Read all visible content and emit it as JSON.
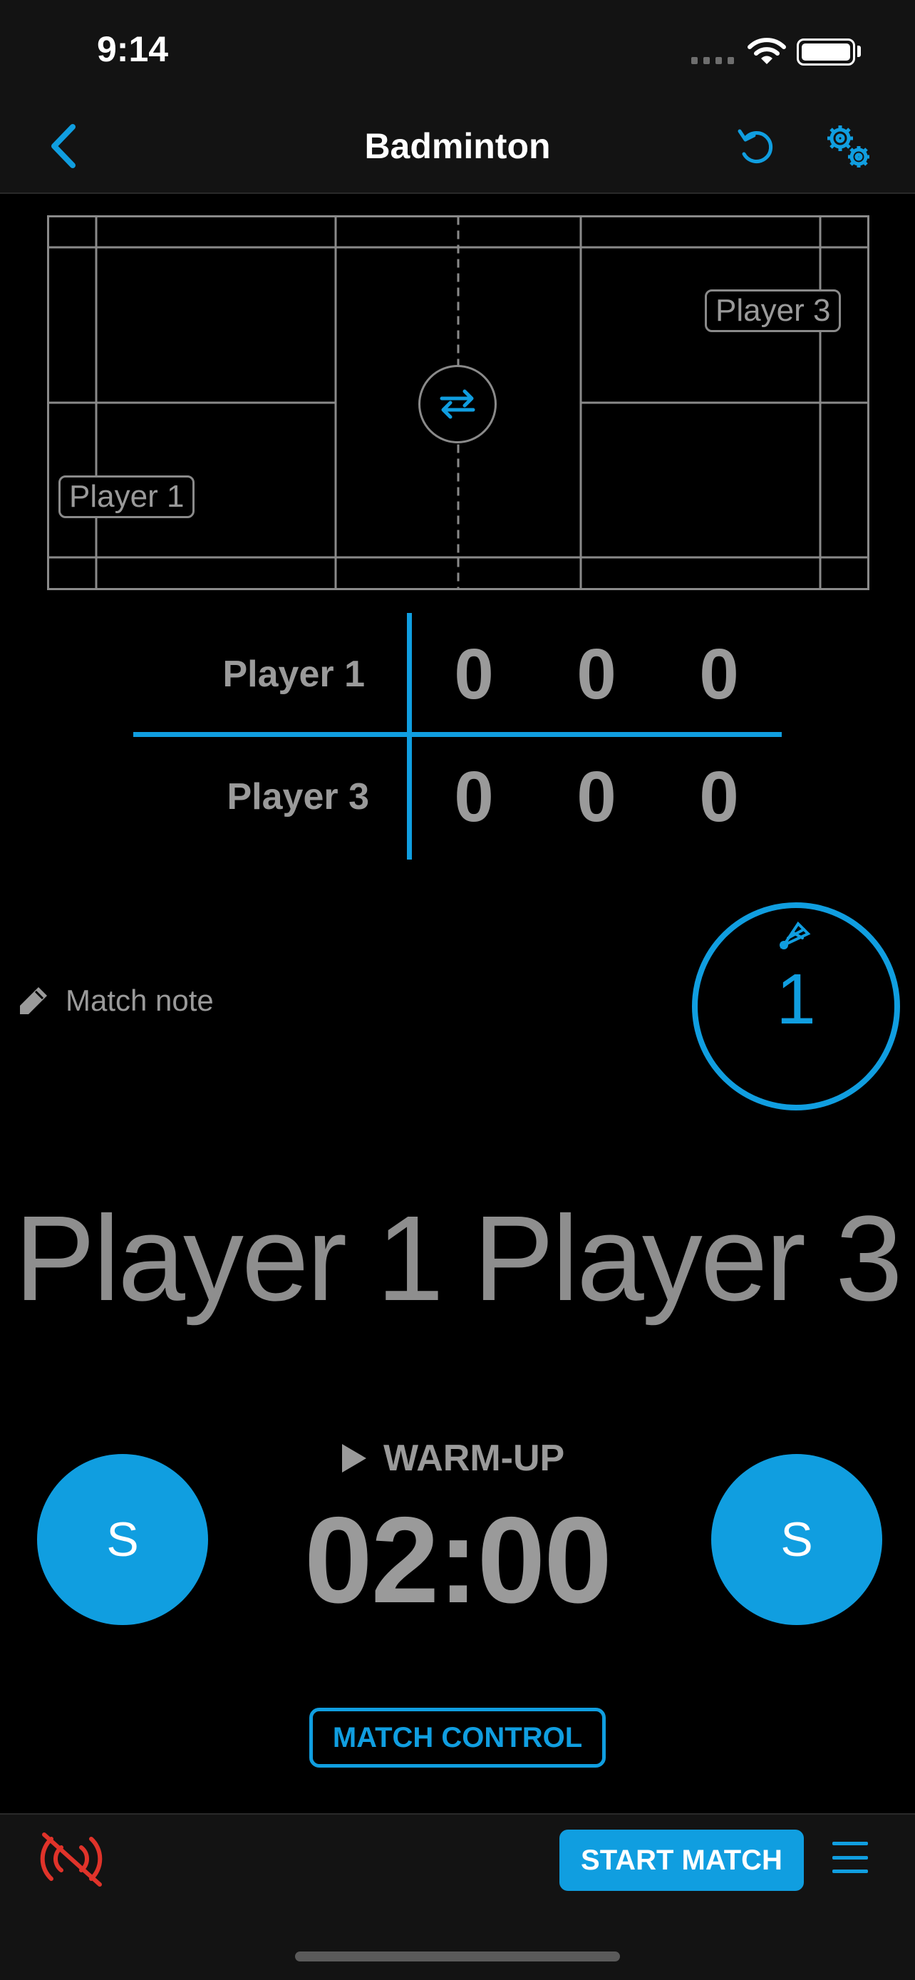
{
  "status_bar": {
    "time": "9:14"
  },
  "nav": {
    "title": "Badminton",
    "back_icon": "chevron-left-icon",
    "undo_icon": "undo-icon",
    "settings_icon": "gears-icon"
  },
  "court": {
    "left_player": "Player 1",
    "right_player": "Player 3",
    "swap_icon": "swap-arrows-icon"
  },
  "scoreboard": {
    "rows": [
      {
        "name": "Player 1",
        "scores": [
          "0",
          "0",
          "0"
        ]
      },
      {
        "name": "Player 3",
        "scores": [
          "0",
          "0",
          "0"
        ]
      }
    ]
  },
  "match_note": {
    "label": "Match note",
    "icon": "pencil-icon"
  },
  "serve": {
    "number": "1",
    "icon": "shuttlecock-icon"
  },
  "big_names": {
    "left": "Player 1",
    "right": "Player 3"
  },
  "timer": {
    "phase": "WARM-UP",
    "time": "02:00",
    "play_icon": "play-icon"
  },
  "serve_buttons": {
    "left": "S",
    "right": "S"
  },
  "match_control": {
    "label": "MATCH CONTROL"
  },
  "bottom_bar": {
    "start_label": "START MATCH",
    "no_signal_icon": "no-signal-icon",
    "menu_icon": "menu-icon"
  },
  "colors": {
    "accent": "#109ee0",
    "muted_text": "#9a9a9a",
    "alert": "#e0332a",
    "bar_bg": "#131313"
  }
}
